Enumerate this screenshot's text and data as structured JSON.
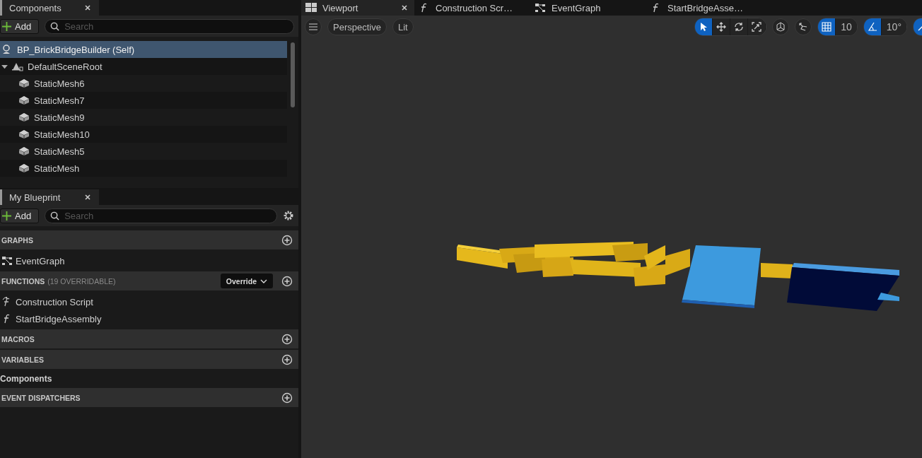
{
  "components_panel": {
    "tab_title": "Components",
    "add_label": "Add",
    "search": {
      "placeholder": "Search"
    },
    "tree": [
      {
        "label": "BP_BrickBridgeBuilder (Self)",
        "kind": "actor",
        "selected": true
      },
      {
        "label": "DefaultSceneRoot",
        "kind": "scene",
        "selected": false,
        "expanded": true,
        "children": [
          {
            "label": "StaticMesh6",
            "kind": "mesh",
            "selected": false
          },
          {
            "label": "StaticMesh7",
            "kind": "mesh",
            "selected": false
          },
          {
            "label": "StaticMesh9",
            "kind": "mesh",
            "selected": false
          },
          {
            "label": "StaticMesh10",
            "kind": "mesh",
            "selected": false
          },
          {
            "label": "StaticMesh5",
            "kind": "mesh",
            "selected": false
          },
          {
            "label": "StaticMesh",
            "kind": "mesh",
            "selected": false
          }
        ]
      }
    ]
  },
  "blueprint_panel": {
    "tab_title": "My Blueprint",
    "add_label": "Add",
    "search": {
      "placeholder": "Search"
    },
    "sections": [
      {
        "title": "GRAPHS",
        "items": [
          {
            "label": "EventGraph",
            "kind": "graph"
          }
        ]
      },
      {
        "title": "FUNCTIONS",
        "note": "(19 OVERRIDABLE)",
        "override_label": "Override",
        "items": [
          {
            "label": "Construction Script",
            "kind": "construction"
          },
          {
            "label": "StartBridgeAssembly",
            "kind": "function"
          }
        ]
      },
      {
        "title": "MACROS"
      },
      {
        "title": "VARIABLES",
        "items": [
          {
            "label": "Components",
            "kind": "category"
          }
        ]
      },
      {
        "title": "EVENT DISPATCHERS"
      }
    ]
  },
  "editor_tabs": [
    {
      "label": "Viewport",
      "kind": "viewport",
      "selected": true
    },
    {
      "label": "Construction Scr…",
      "kind": "function",
      "selected": false
    },
    {
      "label": "EventGraph",
      "kind": "graph",
      "selected": false
    },
    {
      "label": "StartBridgeAsse…",
      "kind": "function",
      "selected": false
    }
  ],
  "viewport": {
    "view_mode": "Perspective",
    "lighting": "Lit",
    "transform_tools": [
      {
        "kind": "select",
        "selected": true
      },
      {
        "kind": "move",
        "selected": false
      },
      {
        "kind": "rotate",
        "selected": false
      },
      {
        "kind": "scale",
        "selected": false
      }
    ],
    "grid_snap": {
      "value": "10",
      "on": true
    },
    "angle_snap": {
      "value": "10°",
      "on": true
    },
    "scale_snap": {
      "on": true
    }
  }
}
